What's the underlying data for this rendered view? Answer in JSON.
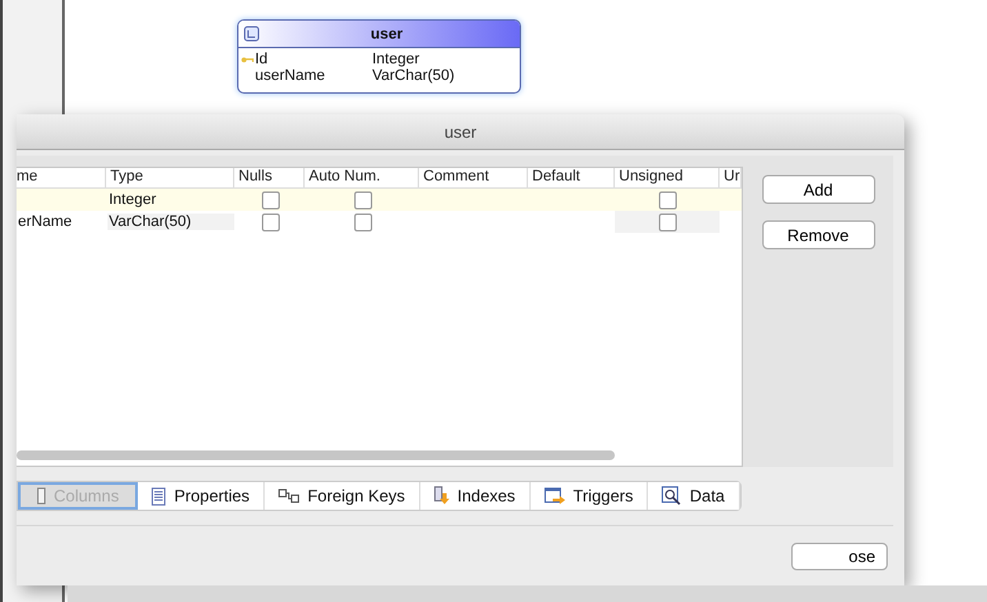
{
  "diagram": {
    "entity": {
      "title": "user",
      "fields": [
        {
          "name": "Id",
          "type": "Integer",
          "primary_key": true
        },
        {
          "name": "userName",
          "type": "VarChar(50)",
          "primary_key": false
        }
      ]
    }
  },
  "dialog": {
    "title": "user",
    "table": {
      "columns": [
        "me",
        "Type",
        "Nulls",
        "Auto Num.",
        "Comment",
        "Default",
        "Unsigned",
        "Ur"
      ],
      "rows": [
        {
          "type": "Integer",
          "nulls": false,
          "auto_num": false,
          "unsigned": false,
          "selected": true
        },
        {
          "name": "erName",
          "type": "VarChar(50)",
          "nulls": false,
          "auto_num": false,
          "unsigned": false,
          "selected": false
        }
      ]
    },
    "buttons": [
      "Add",
      "Remove"
    ],
    "tabs": [
      {
        "label": "Columns",
        "kind": "columns",
        "selected": true
      },
      {
        "label": "Properties",
        "kind": "properties",
        "selected": false
      },
      {
        "label": "Foreign Keys",
        "kind": "foreign_keys",
        "selected": false
      },
      {
        "label": "Indexes",
        "kind": "indexes",
        "selected": false
      },
      {
        "label": "Triggers",
        "kind": "triggers",
        "selected": false
      },
      {
        "label": "Data",
        "kind": "data",
        "selected": false
      }
    ],
    "close_button": "ose"
  }
}
